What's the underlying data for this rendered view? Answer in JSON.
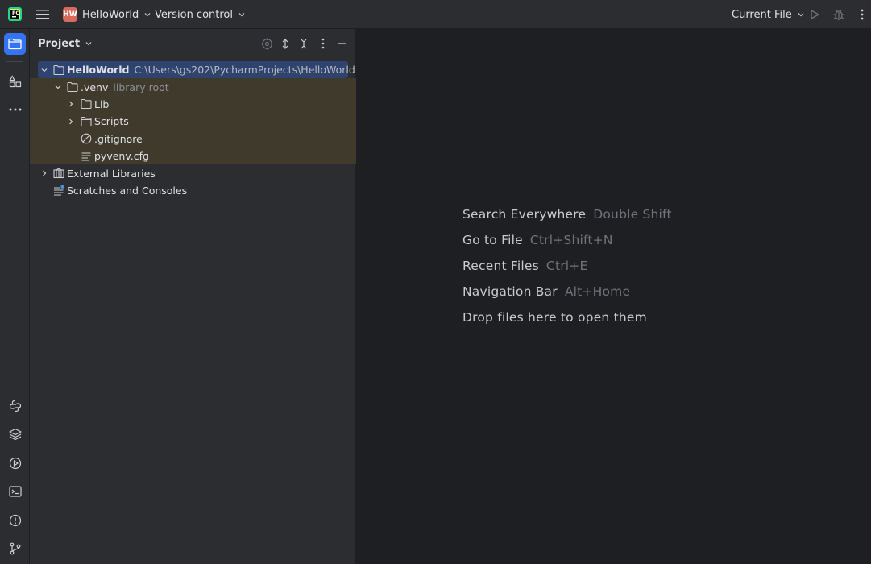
{
  "titlebar": {
    "project_badge": "HW",
    "project_name": "HelloWorld",
    "vcs_label": "Version control",
    "run_config": "Current File",
    "icons": [
      "app-logo",
      "hamburger-menu-icon",
      "chevron-down-icon",
      "run-icon",
      "debug-icon",
      "more-vertical-icon"
    ]
  },
  "stripe": {
    "top": [
      "folder-icon",
      "structure-icon",
      "more-horizontal-icon"
    ],
    "bottom": [
      "python-console-icon",
      "layers-icon",
      "services-icon",
      "terminal-icon",
      "problems-icon",
      "git-icon"
    ]
  },
  "panel": {
    "title": "Project",
    "tools": [
      "locate-icon",
      "expand-all-icon",
      "collapse-all-icon",
      "options-icon",
      "minimize-icon"
    ]
  },
  "tree": {
    "root": {
      "name": "HelloWorld",
      "path": "C:\\Users\\gs202\\PycharmProjects\\HelloWorld"
    },
    "venv": {
      "name": ".venv",
      "note": "library root"
    },
    "lib": "Lib",
    "scripts": "Scripts",
    "gitignore": ".gitignore",
    "pyvenv": "pyvenv.cfg",
    "external": "External Libraries",
    "scratches": "Scratches and Consoles"
  },
  "editor": {
    "hints": [
      {
        "label": "Search Everywhere",
        "key": "Double Shift"
      },
      {
        "label": "Go to File",
        "key": "Ctrl+Shift+N"
      },
      {
        "label": "Recent Files",
        "key": "Ctrl+E"
      },
      {
        "label": "Navigation Bar",
        "key": "Alt+Home"
      },
      {
        "label": "Drop files here to open them",
        "key": ""
      }
    ]
  },
  "colors": {
    "accent": "#3574f0",
    "badge": "#d96a5e",
    "excluded_bg": "#3f3a2c",
    "selection": "#2e436e"
  }
}
